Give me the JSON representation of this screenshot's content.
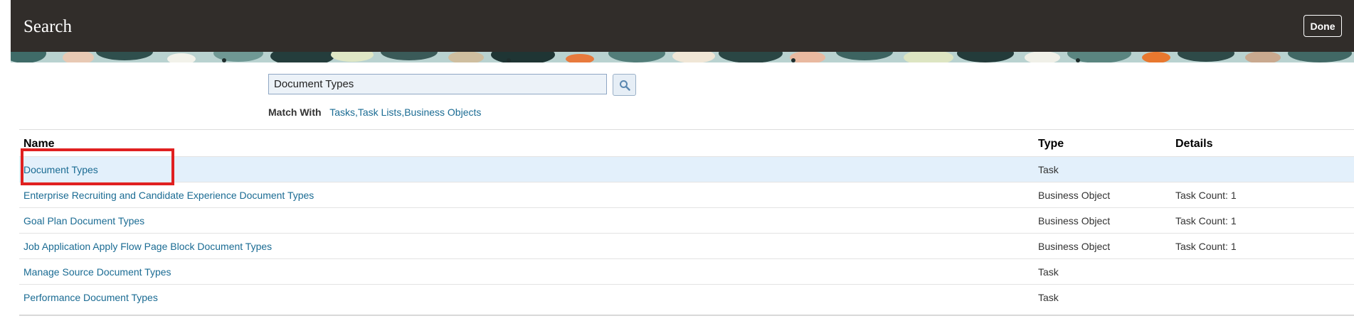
{
  "header": {
    "title": "Search",
    "done_label": "Done"
  },
  "search": {
    "value": "Document Types"
  },
  "match": {
    "label": "Match With",
    "value": "Tasks,Task Lists,Business Objects"
  },
  "table": {
    "columns": [
      "Name",
      "Type",
      "Details"
    ],
    "rows": [
      {
        "name": "Document Types",
        "type": "Task",
        "details": "",
        "selected": true
      },
      {
        "name": "Enterprise Recruiting and Candidate Experience Document Types",
        "type": "Business Object",
        "details": "Task Count: 1"
      },
      {
        "name": "Goal Plan Document Types",
        "type": "Business Object",
        "details": "Task Count: 1"
      },
      {
        "name": "Job Application Apply Flow Page Block Document Types",
        "type": "Business Object",
        "details": "Task Count: 1"
      },
      {
        "name": "Manage Source Document Types",
        "type": "Task",
        "details": ""
      },
      {
        "name": "Performance Document Types",
        "type": "Task",
        "details": ""
      }
    ]
  },
  "colors": {
    "header_bg": "#312d2a",
    "link": "#1a6b93",
    "selected_row": "#e3f0fb",
    "highlight": "#e02020"
  }
}
